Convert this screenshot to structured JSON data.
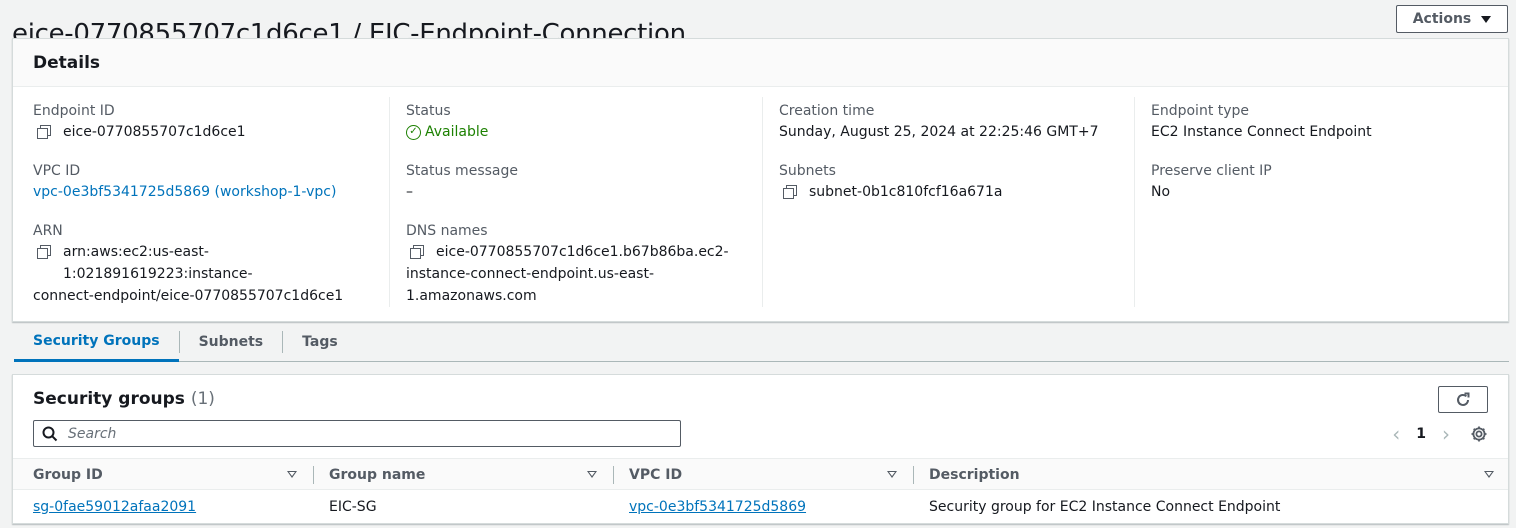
{
  "header": {
    "title": "eice-0770855707c1d6ce1 / EIC-Endpoint-Connection",
    "actions_label": "Actions"
  },
  "details": {
    "heading": "Details",
    "endpoint_id": {
      "label": "Endpoint ID",
      "value": "eice-0770855707c1d6ce1"
    },
    "vpc_id": {
      "label": "VPC ID",
      "value": "vpc-0e3bf5341725d5869 (workshop-1-vpc)"
    },
    "arn": {
      "label": "ARN",
      "line1": "arn:aws:ec2:us-east-1:021891619223:instance-",
      "line2": "connect-endpoint/eice-0770855707c1d6ce1"
    },
    "status": {
      "label": "Status",
      "value": "Available"
    },
    "status_message": {
      "label": "Status message",
      "value": "–"
    },
    "dns_names": {
      "label": "DNS names",
      "line1": "eice-0770855707c1d6ce1.b67b86ba.ec2-",
      "line2": "instance-connect-endpoint.us-east-",
      "line3": "1.amazonaws.com"
    },
    "creation_time": {
      "label": "Creation time",
      "value": "Sunday, August 25, 2024 at 22:25:46 GMT+7"
    },
    "subnets": {
      "label": "Subnets",
      "value": "subnet-0b1c810fcf16a671a"
    },
    "endpoint_type": {
      "label": "Endpoint type",
      "value": "EC2 Instance Connect Endpoint"
    },
    "preserve_client_ip": {
      "label": "Preserve client IP",
      "value": "No"
    }
  },
  "tabs": [
    {
      "label": "Security Groups",
      "active": true
    },
    {
      "label": "Subnets",
      "active": false
    },
    {
      "label": "Tags",
      "active": false
    }
  ],
  "security_groups": {
    "title": "Security groups",
    "count": "(1)",
    "search_placeholder": "Search",
    "page": "1",
    "columns": [
      "Group ID",
      "Group name",
      "VPC ID",
      "Description"
    ],
    "rows": [
      {
        "group_id": "sg-0fae59012afaa2091",
        "group_name": "EIC-SG",
        "vpc_id": "vpc-0e3bf5341725d5869",
        "description": "Security group for EC2 Instance Connect Endpoint"
      }
    ]
  },
  "colors": {
    "link": "#0073bb",
    "success": "#1d8102",
    "text": "#16191f",
    "muted": "#545b64"
  },
  "icons": [
    "copy-icon",
    "check-circle-icon",
    "caret-down-icon",
    "refresh-icon",
    "search-icon",
    "chevron-left-icon",
    "chevron-right-icon",
    "settings-gear-icon",
    "sort-icon"
  ]
}
